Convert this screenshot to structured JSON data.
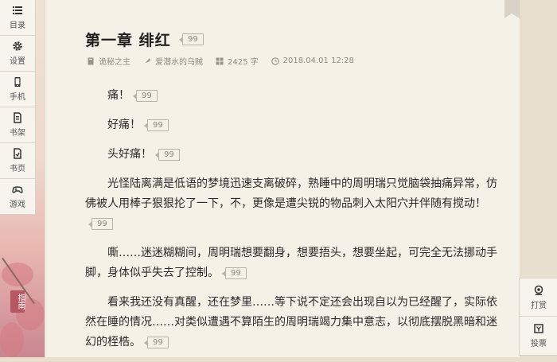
{
  "sidebar": {
    "items": [
      {
        "icon": "list-icon",
        "label": "目录"
      },
      {
        "icon": "gear-icon",
        "label": "设置"
      },
      {
        "icon": "phone-icon",
        "label": "手机"
      },
      {
        "icon": "bookshelf-icon",
        "label": "书架"
      },
      {
        "icon": "book-page-icon",
        "label": "书页"
      },
      {
        "icon": "gamepad-icon",
        "label": "游戏"
      }
    ],
    "guide_label": "指南"
  },
  "chapter": {
    "title": "第一章 绯红",
    "comment_count": "99",
    "book": "诡秘之主",
    "author": "爱潜水的乌贼",
    "word_count": "2425 字",
    "datetime": "2018.04.01 12:28"
  },
  "paragraphs": [
    {
      "text": "痛！",
      "comments": "99"
    },
    {
      "text": "好痛！",
      "comments": "99"
    },
    {
      "text": "头好痛！",
      "comments": "99"
    },
    {
      "text": "光怪陆离满是低语的梦境迅速支离破碎，熟睡中的周明瑞只觉脑袋抽痛异常，仿佛被人用棒子狠狠抡了一下，不，更像是遭尖锐的物品刺入太阳穴并伴随有搅动！",
      "comments": "99"
    },
    {
      "text": "嘶……迷迷糊糊间，周明瑞想要翻身，想要捂头，想要坐起，可完全无法挪动手脚，身体似乎失去了控制。",
      "comments": "99"
    },
    {
      "text": "看来我还没有真醒，还在梦里……等下说不定还会出现自以为已经醒了，实际依然在睡的情况……对类似遭遇不算陌生的周明瑞竭力集中意志，以彻底摆脱黑暗和迷幻的桎梏。",
      "comments": "99"
    }
  ],
  "right_bar": {
    "tip_label": "打赏",
    "vote_label": "投票"
  }
}
